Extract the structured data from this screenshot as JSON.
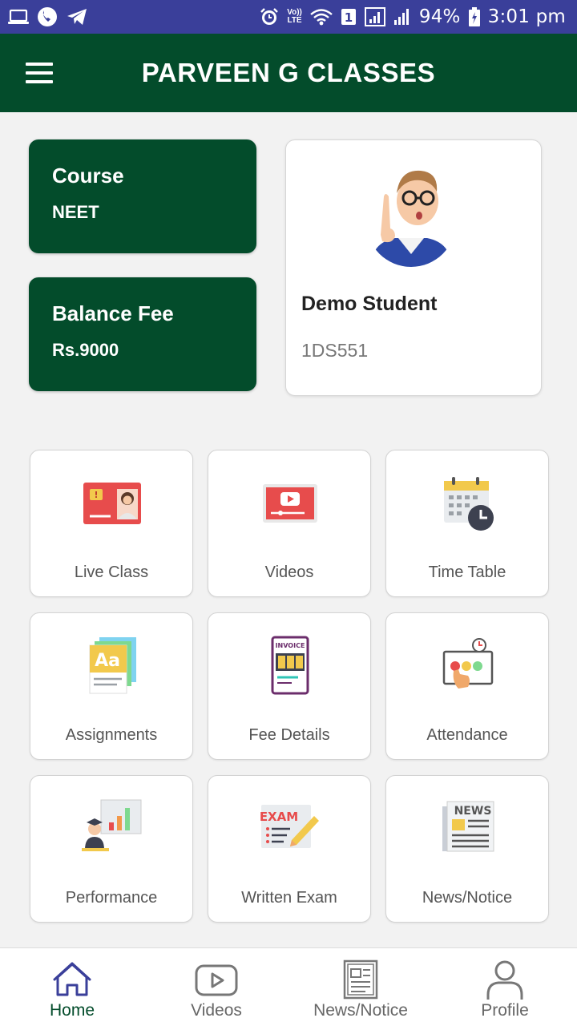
{
  "status_bar": {
    "battery": "94%",
    "time": "3:01 pm",
    "volte_top": "Vo))",
    "volte_bottom": "LTE",
    "sim_badge": "1"
  },
  "app_bar": {
    "title": "PARVEEN G CLASSES"
  },
  "info": {
    "course_label": "Course",
    "course_value": "NEET",
    "fee_label": "Balance Fee",
    "fee_value": "Rs.9000"
  },
  "student": {
    "name": "Demo Student",
    "id": "1DS551"
  },
  "tiles": [
    {
      "label": "Live Class",
      "icon": "live-class-icon"
    },
    {
      "label": "Videos",
      "icon": "video-player-icon"
    },
    {
      "label": "Time Table",
      "icon": "calendar-clock-icon"
    },
    {
      "label": "Assignments",
      "icon": "assignment-sheets-icon"
    },
    {
      "label": "Fee Details",
      "icon": "invoice-icon"
    },
    {
      "label": "Attendance",
      "icon": "attendance-board-icon"
    },
    {
      "label": "Performance",
      "icon": "performance-chart-icon"
    },
    {
      "label": "Written Exam",
      "icon": "exam-paper-icon"
    },
    {
      "label": "News/Notice",
      "icon": "newspaper-icon"
    }
  ],
  "bottom_nav": [
    {
      "label": "Home",
      "icon": "home-icon",
      "active": true
    },
    {
      "label": "Videos",
      "icon": "play-icon",
      "active": false
    },
    {
      "label": "News/Notice",
      "icon": "news-icon",
      "active": false
    },
    {
      "label": "Profile",
      "icon": "person-icon",
      "active": false
    }
  ],
  "colors": {
    "status_bar": "#3a3f9a",
    "primary": "#034c2b",
    "background": "#f2f2f2"
  }
}
